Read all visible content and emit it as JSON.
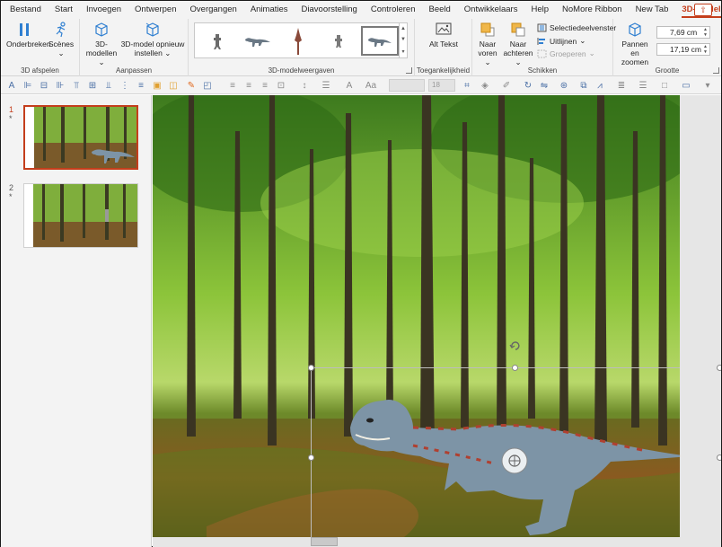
{
  "tabs": [
    "Bestand",
    "Start",
    "Invoegen",
    "Ontwerpen",
    "Overgangen",
    "Animaties",
    "Diavoorstelling",
    "Controleren",
    "Beeld",
    "Ontwikkelaars",
    "Help",
    "NoMore Ribbon",
    "New Tab",
    "3D-model"
  ],
  "active_tab": "3D-model",
  "ribbon": {
    "afspelen": {
      "label": "3D afspelen",
      "pause": "Onderbreken",
      "scenes": "Scènes"
    },
    "aanpassen": {
      "label": "Aanpassen",
      "models": "3D-modellen",
      "reset": "3D-model opnieuw instellen"
    },
    "weergaven": {
      "label": "3D-modelweergaven"
    },
    "toegankelijkheid": {
      "label": "Toegankelijkheid",
      "alt": "Alt Tekst"
    },
    "schikken": {
      "label": "Schikken",
      "forward": "Naar voren",
      "backward": "Naar achteren",
      "selection_pane": "Selectiedeelvenster",
      "align": "Uitlijnen",
      "group": "Groeperen"
    },
    "grootte": {
      "label": "Grootte",
      "pan_zoom": "Pannen en zoomen",
      "height": "7,69 cm",
      "width": "17,19 cm"
    }
  },
  "toolbar": {
    "font_size": "18"
  },
  "slides": [
    {
      "number": "1",
      "star": "*"
    },
    {
      "number": "2",
      "star": "*"
    }
  ],
  "colors": {
    "accent": "#c43e1c",
    "ribbon_bg": "#f3f3f3"
  }
}
